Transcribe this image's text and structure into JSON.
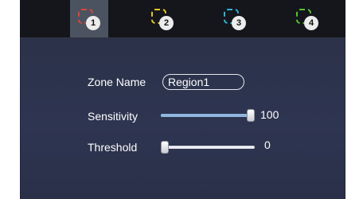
{
  "tabs": [
    {
      "number": "1",
      "color": "#d9463a",
      "active": true
    },
    {
      "number": "2",
      "color": "#e8c81e",
      "active": false
    },
    {
      "number": "3",
      "color": "#2fb3d6",
      "active": false
    },
    {
      "number": "4",
      "color": "#55c42e",
      "active": false
    }
  ],
  "zone_name": {
    "label": "Zone Name",
    "value": "Region1"
  },
  "sensitivity": {
    "label": "Sensitivity",
    "value": "100",
    "fraction": 1.0
  },
  "threshold": {
    "label": "Threshold",
    "value": "0",
    "fraction": 0.0
  }
}
